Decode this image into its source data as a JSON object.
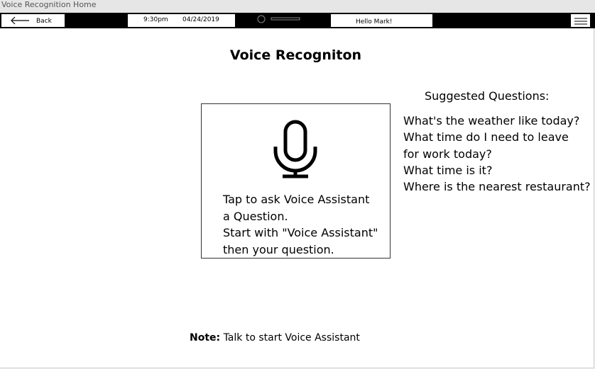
{
  "window": {
    "title": "Voice Recognition Home"
  },
  "topbar": {
    "back_label": "Back",
    "time": "9:30pm",
    "date": "04/24/2019",
    "greeting": "Hello Mark!"
  },
  "main": {
    "title": "Voice Recogniton",
    "voice_box": {
      "lines": [
        "Tap to ask Voice Assistant",
        "a Question.",
        "Start with \"Voice Assistant\"",
        "then your question."
      ]
    },
    "suggested": {
      "title": "Suggested Questions:",
      "questions": [
        "What's the weather like today?",
        "What time do I need to leave",
        "for work today?",
        "What time is it?",
        "Where is the nearest restaurant?"
      ]
    },
    "note": {
      "label": "Note:",
      "text": " Talk to start Voice Assistant"
    }
  },
  "icons": {
    "back": "arrow-left-icon",
    "media": "media-scrubber-icon",
    "menu": "hamburger-menu-icon",
    "mic": "microphone-icon"
  }
}
